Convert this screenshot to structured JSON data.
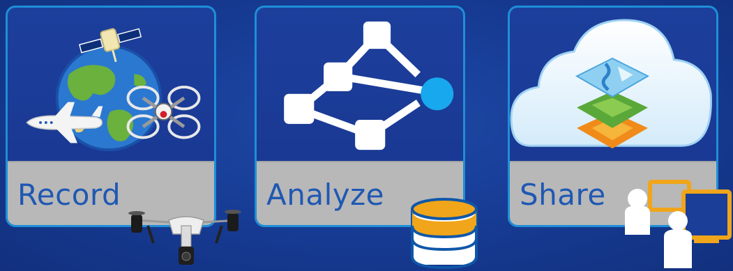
{
  "cards": [
    {
      "label": "Record",
      "icon": "globe-satellite-plane-drone-icon"
    },
    {
      "label": "Analyze",
      "icon": "network-graph-icon"
    },
    {
      "label": "Share",
      "icon": "cloud-map-layers-icon"
    }
  ],
  "overlays": {
    "drone": "quadcopter-drone-icon",
    "database": "database-icon",
    "users": "users-computers-icon"
  },
  "colors": {
    "background": "#173d97",
    "card_border": "#1e8fd8",
    "label_bar": "#b8b8b8",
    "label_text": "#1f58b3",
    "accent_cyan": "#18a8ee",
    "accent_orange": "#f0a51a"
  }
}
